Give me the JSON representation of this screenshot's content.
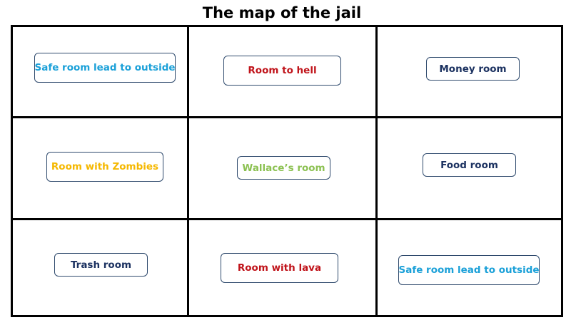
{
  "title": "The map of the jail",
  "rooms": [
    {
      "label": "Safe room lead to outside",
      "color": "#1aa0d8"
    },
    {
      "label": "Room to hell",
      "color": "#c0131a"
    },
    {
      "label": "Money room",
      "color": "#1b3160"
    },
    {
      "label": "Room with Zombies",
      "color": "#f5b800"
    },
    {
      "label": "Wallace’s room",
      "color": "#8cc152"
    },
    {
      "label": "Food room",
      "color": "#1b3160"
    },
    {
      "label": "Trash room",
      "color": "#1b3160"
    },
    {
      "label": "Room with lava",
      "color": "#c0131a"
    },
    {
      "label": "Safe room lead to outside",
      "color": "#1aa0d8"
    }
  ]
}
